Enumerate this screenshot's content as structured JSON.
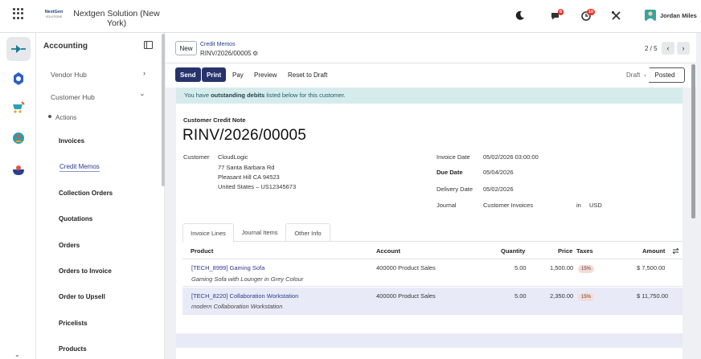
{
  "topbar": {
    "company_logo_line1": "NextGen",
    "company_logo_line2": "SOLUTIONS",
    "company_name": "Nextgen Solution (New York)",
    "chat_badge": "6",
    "activity_badge": "10",
    "user_name": "Jordan Miles"
  },
  "sidebar": {
    "title": "Accounting",
    "vendor_hub": "Vendor Hub",
    "customer_hub": "Customer Hub",
    "actions": "Actions",
    "items": [
      "Invoices",
      "Credit Memos",
      "Collection Orders",
      "Quotations",
      "Orders",
      "Orders to Invoice",
      "Order to Upsell",
      "Pricelists",
      "Products"
    ]
  },
  "header": {
    "new_label": "New",
    "breadcrumb_parent": "Credit Memos",
    "breadcrumb_current": "RINV/2026/00005",
    "pager": "2 / 5"
  },
  "actions": {
    "send": "Send",
    "print": "Print",
    "pay": "Pay",
    "preview": "Preview",
    "reset": "Reset to Draft",
    "status_draft": "Draft",
    "status_posted": "Posted"
  },
  "alert": {
    "prefix": "You have ",
    "bold": "outstanding debits",
    "suffix": " listed below for this customer."
  },
  "document": {
    "type": "Customer Credit Note",
    "number": "RINV/2026/00005",
    "customer_label": "Customer",
    "customer_name": "CloudLogic",
    "address1": "77 Santa Barbara Rd",
    "address2": "Pleasant Hill CA 94523",
    "address3": "United States – US12345673",
    "invoice_date_label": "Invoice Date",
    "invoice_date": "05/02/2026 03:00:00",
    "due_date_label": "Due Date",
    "due_date": "05/04/2026",
    "delivery_date_label": "Delivery Date",
    "delivery_date": "05/02/2026",
    "journal_label": "Journal",
    "journal": "Customer Invoices",
    "in_label": "in",
    "currency": "USD"
  },
  "tabs": [
    "Invoice Lines",
    "Journal Items",
    "Other Info"
  ],
  "table": {
    "headers": {
      "product": "Product",
      "account": "Account",
      "quantity": "Quantity",
      "price": "Price",
      "taxes": "Taxes",
      "amount": "Amount"
    },
    "rows": [
      {
        "product": "[TECH_8999] Gaming Sofa",
        "description": "Gaming Sofa with Lounger in Grey Colour",
        "account": "400000 Product Sales",
        "quantity": "5.00",
        "price": "1,500.00",
        "tax": "15%",
        "amount": "$ 7,500.00"
      },
      {
        "product": "[TECH_8220] Collaboration Workstation",
        "description": "modern Collaboration Workstation",
        "account": "400000 Product Sales",
        "quantity": "5.00",
        "price": "2,350.00",
        "tax": "15%",
        "amount": "$ 11,750.00"
      }
    ]
  },
  "colors": {
    "primary": "#27336b",
    "alert_bg": "#d6ecec",
    "row_highlight": "#e8ebf7",
    "badge": "#e4372e"
  }
}
